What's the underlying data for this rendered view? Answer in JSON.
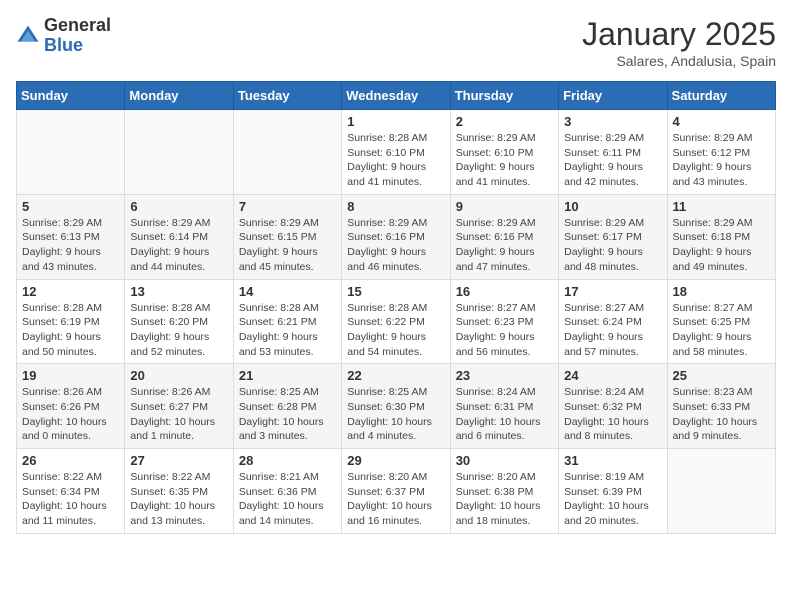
{
  "header": {
    "logo": {
      "general": "General",
      "blue": "Blue"
    },
    "title": "January 2025",
    "location": "Salares, Andalusia, Spain"
  },
  "weekdays": [
    "Sunday",
    "Monday",
    "Tuesday",
    "Wednesday",
    "Thursday",
    "Friday",
    "Saturday"
  ],
  "weeks": [
    [
      {
        "day": "",
        "info": ""
      },
      {
        "day": "",
        "info": ""
      },
      {
        "day": "",
        "info": ""
      },
      {
        "day": "1",
        "info": "Sunrise: 8:28 AM\nSunset: 6:10 PM\nDaylight: 9 hours\nand 41 minutes."
      },
      {
        "day": "2",
        "info": "Sunrise: 8:29 AM\nSunset: 6:10 PM\nDaylight: 9 hours\nand 41 minutes."
      },
      {
        "day": "3",
        "info": "Sunrise: 8:29 AM\nSunset: 6:11 PM\nDaylight: 9 hours\nand 42 minutes."
      },
      {
        "day": "4",
        "info": "Sunrise: 8:29 AM\nSunset: 6:12 PM\nDaylight: 9 hours\nand 43 minutes."
      }
    ],
    [
      {
        "day": "5",
        "info": "Sunrise: 8:29 AM\nSunset: 6:13 PM\nDaylight: 9 hours\nand 43 minutes."
      },
      {
        "day": "6",
        "info": "Sunrise: 8:29 AM\nSunset: 6:14 PM\nDaylight: 9 hours\nand 44 minutes."
      },
      {
        "day": "7",
        "info": "Sunrise: 8:29 AM\nSunset: 6:15 PM\nDaylight: 9 hours\nand 45 minutes."
      },
      {
        "day": "8",
        "info": "Sunrise: 8:29 AM\nSunset: 6:16 PM\nDaylight: 9 hours\nand 46 minutes."
      },
      {
        "day": "9",
        "info": "Sunrise: 8:29 AM\nSunset: 6:16 PM\nDaylight: 9 hours\nand 47 minutes."
      },
      {
        "day": "10",
        "info": "Sunrise: 8:29 AM\nSunset: 6:17 PM\nDaylight: 9 hours\nand 48 minutes."
      },
      {
        "day": "11",
        "info": "Sunrise: 8:29 AM\nSunset: 6:18 PM\nDaylight: 9 hours\nand 49 minutes."
      }
    ],
    [
      {
        "day": "12",
        "info": "Sunrise: 8:28 AM\nSunset: 6:19 PM\nDaylight: 9 hours\nand 50 minutes."
      },
      {
        "day": "13",
        "info": "Sunrise: 8:28 AM\nSunset: 6:20 PM\nDaylight: 9 hours\nand 52 minutes."
      },
      {
        "day": "14",
        "info": "Sunrise: 8:28 AM\nSunset: 6:21 PM\nDaylight: 9 hours\nand 53 minutes."
      },
      {
        "day": "15",
        "info": "Sunrise: 8:28 AM\nSunset: 6:22 PM\nDaylight: 9 hours\nand 54 minutes."
      },
      {
        "day": "16",
        "info": "Sunrise: 8:27 AM\nSunset: 6:23 PM\nDaylight: 9 hours\nand 56 minutes."
      },
      {
        "day": "17",
        "info": "Sunrise: 8:27 AM\nSunset: 6:24 PM\nDaylight: 9 hours\nand 57 minutes."
      },
      {
        "day": "18",
        "info": "Sunrise: 8:27 AM\nSunset: 6:25 PM\nDaylight: 9 hours\nand 58 minutes."
      }
    ],
    [
      {
        "day": "19",
        "info": "Sunrise: 8:26 AM\nSunset: 6:26 PM\nDaylight: 10 hours\nand 0 minutes."
      },
      {
        "day": "20",
        "info": "Sunrise: 8:26 AM\nSunset: 6:27 PM\nDaylight: 10 hours\nand 1 minute."
      },
      {
        "day": "21",
        "info": "Sunrise: 8:25 AM\nSunset: 6:28 PM\nDaylight: 10 hours\nand 3 minutes."
      },
      {
        "day": "22",
        "info": "Sunrise: 8:25 AM\nSunset: 6:30 PM\nDaylight: 10 hours\nand 4 minutes."
      },
      {
        "day": "23",
        "info": "Sunrise: 8:24 AM\nSunset: 6:31 PM\nDaylight: 10 hours\nand 6 minutes."
      },
      {
        "day": "24",
        "info": "Sunrise: 8:24 AM\nSunset: 6:32 PM\nDaylight: 10 hours\nand 8 minutes."
      },
      {
        "day": "25",
        "info": "Sunrise: 8:23 AM\nSunset: 6:33 PM\nDaylight: 10 hours\nand 9 minutes."
      }
    ],
    [
      {
        "day": "26",
        "info": "Sunrise: 8:22 AM\nSunset: 6:34 PM\nDaylight: 10 hours\nand 11 minutes."
      },
      {
        "day": "27",
        "info": "Sunrise: 8:22 AM\nSunset: 6:35 PM\nDaylight: 10 hours\nand 13 minutes."
      },
      {
        "day": "28",
        "info": "Sunrise: 8:21 AM\nSunset: 6:36 PM\nDaylight: 10 hours\nand 14 minutes."
      },
      {
        "day": "29",
        "info": "Sunrise: 8:20 AM\nSunset: 6:37 PM\nDaylight: 10 hours\nand 16 minutes."
      },
      {
        "day": "30",
        "info": "Sunrise: 8:20 AM\nSunset: 6:38 PM\nDaylight: 10 hours\nand 18 minutes."
      },
      {
        "day": "31",
        "info": "Sunrise: 8:19 AM\nSunset: 6:39 PM\nDaylight: 10 hours\nand 20 minutes."
      },
      {
        "day": "",
        "info": ""
      }
    ]
  ]
}
